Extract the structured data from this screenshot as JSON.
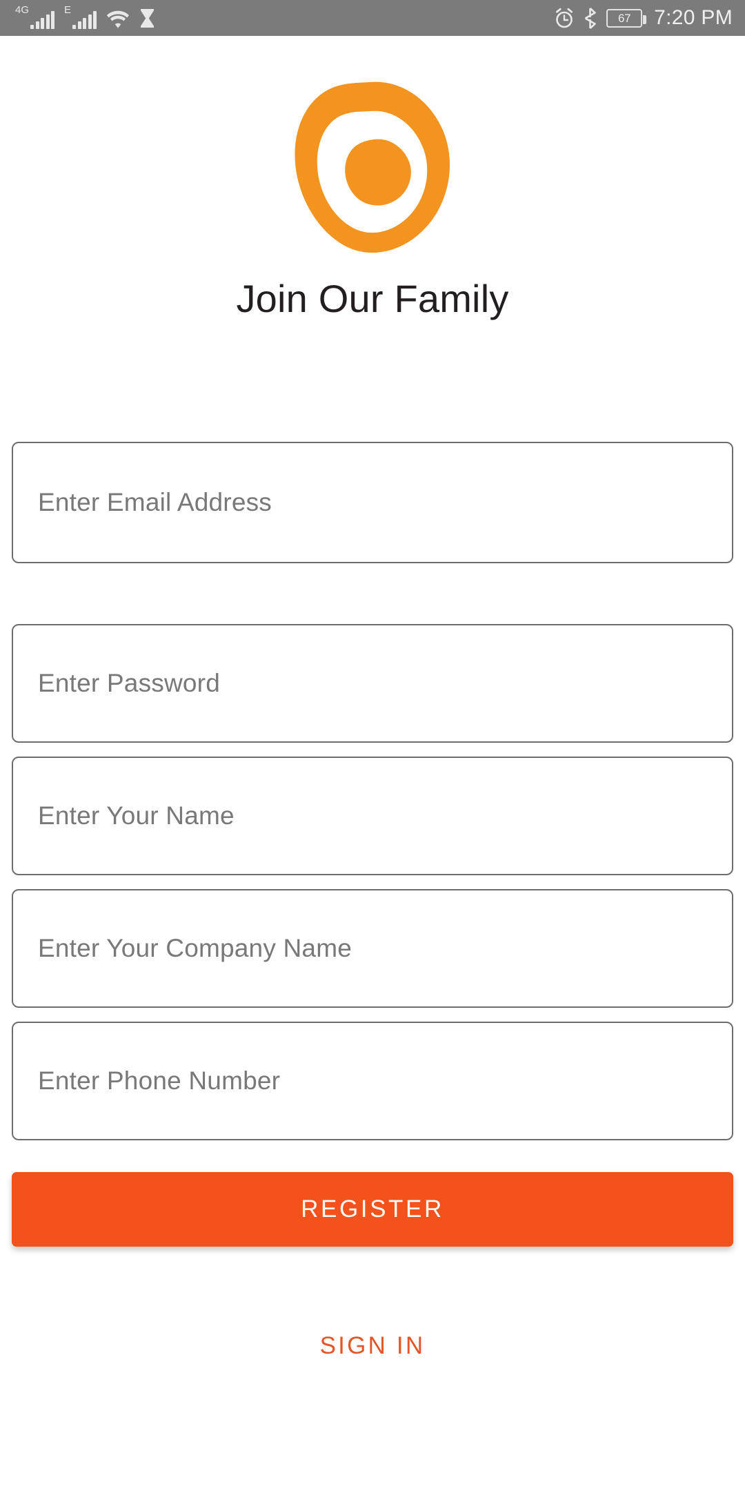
{
  "status_bar": {
    "background_color": "#7b7b7b",
    "left_icons": [
      {
        "name": "signal-4g",
        "label": "4G",
        "bars": 5
      },
      {
        "name": "signal-edge",
        "label": "E",
        "bars": 5
      },
      {
        "name": "wifi-icon",
        "label": ""
      },
      {
        "name": "hourglass-icon",
        "label": ""
      }
    ],
    "right_icons": [
      {
        "name": "alarm-icon",
        "label": ""
      },
      {
        "name": "bluetooth-icon",
        "label": ""
      }
    ],
    "battery_level": "67",
    "time": "7:20 PM"
  },
  "brand": {
    "logo_name": "app-logo",
    "logo_color": "#f2941f",
    "accent_color": "#f4521c",
    "link_color": "#e3562a"
  },
  "header": {
    "title": "Join Our Family"
  },
  "form": {
    "fields": [
      {
        "name": "email-field",
        "placeholder": "Enter Email Address",
        "value": "",
        "type": "email"
      },
      {
        "name": "password-field",
        "placeholder": "Enter Password",
        "value": "",
        "type": "password"
      },
      {
        "name": "full-name-field",
        "placeholder": "Enter Your Name",
        "value": "",
        "type": "text"
      },
      {
        "name": "company-name-field",
        "placeholder": "Enter Your Company Name",
        "value": "",
        "type": "text"
      },
      {
        "name": "phone-field",
        "placeholder": "Enter Phone Number",
        "value": "",
        "type": "tel"
      }
    ],
    "register_label": "REGISTER",
    "signin_label": "SIGN IN"
  }
}
